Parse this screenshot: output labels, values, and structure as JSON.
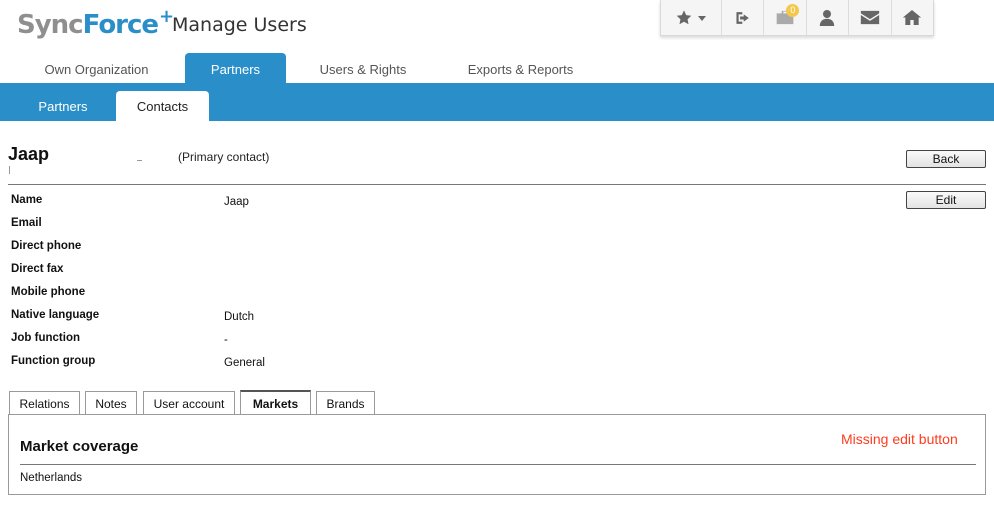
{
  "header": {
    "logo_sync": "Sync",
    "logo_force": "Force",
    "logo_plus": "+",
    "app_title": "Manage Users",
    "notification_count": "0",
    "toolbar_icons": [
      "star-icon",
      "chevron-down-icon",
      "logout-icon",
      "briefcase-icon",
      "user-icon",
      "envelope-icon",
      "home-icon"
    ]
  },
  "main_tabs": [
    {
      "label": "Own Organization",
      "active": false
    },
    {
      "label": "Partners",
      "active": true
    },
    {
      "label": "Users & Rights",
      "active": false
    },
    {
      "label": "Exports & Reports",
      "active": false
    }
  ],
  "sub_tabs": [
    {
      "label": "Partners",
      "active": false
    },
    {
      "label": "Contacts",
      "active": true
    }
  ],
  "contact": {
    "name": "Jaap",
    "primary_label": "(Primary contact)",
    "back_label": "Back",
    "edit_label": "Edit"
  },
  "fields": [
    {
      "label": "Name",
      "value": "Jaap"
    },
    {
      "label": "Email",
      "value": ""
    },
    {
      "label": "Direct phone",
      "value": ""
    },
    {
      "label": "Direct fax",
      "value": ""
    },
    {
      "label": "Mobile phone",
      "value": ""
    },
    {
      "label": "Native language",
      "value": "Dutch"
    },
    {
      "label": "Job function",
      "value": "-"
    },
    {
      "label": "Function group",
      "value": "General"
    }
  ],
  "detail_tabs": [
    {
      "label": "Relations",
      "active": false
    },
    {
      "label": "Notes",
      "active": false
    },
    {
      "label": "User account",
      "active": false
    },
    {
      "label": "Markets",
      "active": true
    },
    {
      "label": "Brands",
      "active": false
    }
  ],
  "markets_panel": {
    "title": "Market coverage",
    "value": "Netherlands",
    "annotation": "Missing edit button"
  },
  "colors": {
    "brand_blue": "#2a8fc9",
    "logo_gray": "#8f8f8f",
    "annotation_red": "#ff3b1f",
    "badge_yellow": "#f2c94c"
  }
}
